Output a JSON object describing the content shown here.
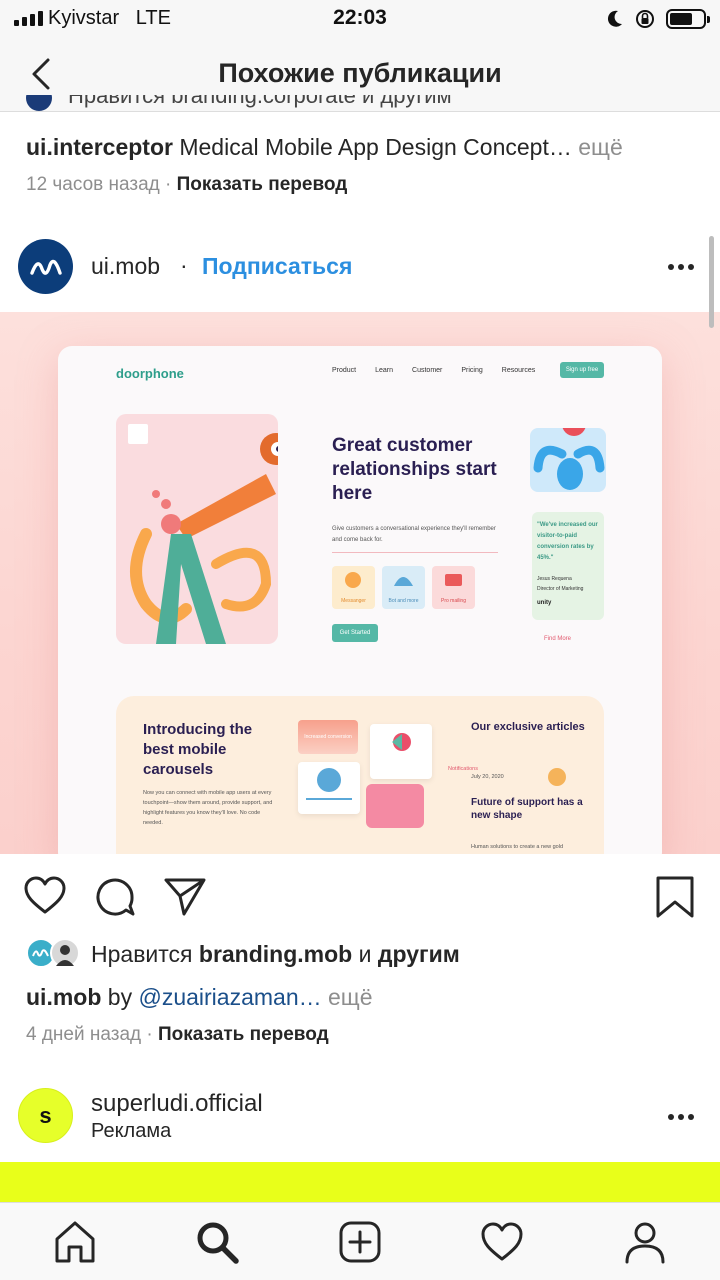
{
  "status_bar": {
    "carrier": "Kyivstar",
    "network": "LTE",
    "time": "22:03"
  },
  "header": {
    "title": "Похожие публикации"
  },
  "previous_post": {
    "likes_partial": "Нравится branding.corporate и другим",
    "username": "ui.interceptor",
    "caption": "Medical Mobile App Design Concept…",
    "more": "ещё",
    "time": "12 часов назад",
    "separator": "·",
    "translate": "Показать перевод"
  },
  "post": {
    "username": "ui.mob",
    "dot": "·",
    "follow": "Подписаться",
    "image": {
      "logo": "doorphone",
      "menu": [
        "Product",
        "Learn",
        "Customer",
        "Pricing",
        "Resources"
      ],
      "signup": "Sign up free",
      "hero_title": "Great customer relationships start here",
      "hero_sub": "Give customers a conversational experience they'll remember and come back for.",
      "features": [
        "Messanger",
        "Bot and more",
        "Pro mailing"
      ],
      "cta": "Get Started",
      "quote": "\"We've increased our visitor-to-paid conversion rates by 45%.\"",
      "quote_name": "Jesus Requena",
      "quote_role": "Director of Marketing",
      "quote_logo": "unity",
      "find_more": "Find More",
      "sec2_title": "Introducing the best mobile carousels",
      "sec2_sub": "Now you can connect with mobile app users at every touchpoint—show them around, provide support, and highlight features you know they'll love. No code needed.",
      "notif_label": "Notifications",
      "pill_label": "Increased conversion",
      "articles_title": "Our exclusive articles",
      "article_date": "July 20, 2020",
      "article_head": "Future of support has a new shape",
      "article_body": "Human solutions to create a new gold"
    },
    "likes_prefix": "Нравится",
    "likes_user": "branding.mob",
    "likes_and": "и",
    "likes_others": "другим",
    "caption_user": "ui.mob",
    "caption_by": "by",
    "caption_mention": "@zuairiazaman…",
    "more": "ещё",
    "time": "4 дней назад",
    "separator": "·",
    "translate": "Показать перевод"
  },
  "next_post": {
    "avatar_letter": "s",
    "username": "superludi.official",
    "subtitle": "Реклама"
  },
  "colors": {
    "link_blue": "#2c8fe0",
    "accent_teal": "#55b8a6",
    "ad_yellow": "#e8ff1a"
  },
  "icons": [
    "back-chevron-icon",
    "heart-icon",
    "comment-icon",
    "share-icon",
    "bookmark-icon",
    "home-icon",
    "search-icon",
    "add-post-icon",
    "activity-icon",
    "profile-icon"
  ]
}
